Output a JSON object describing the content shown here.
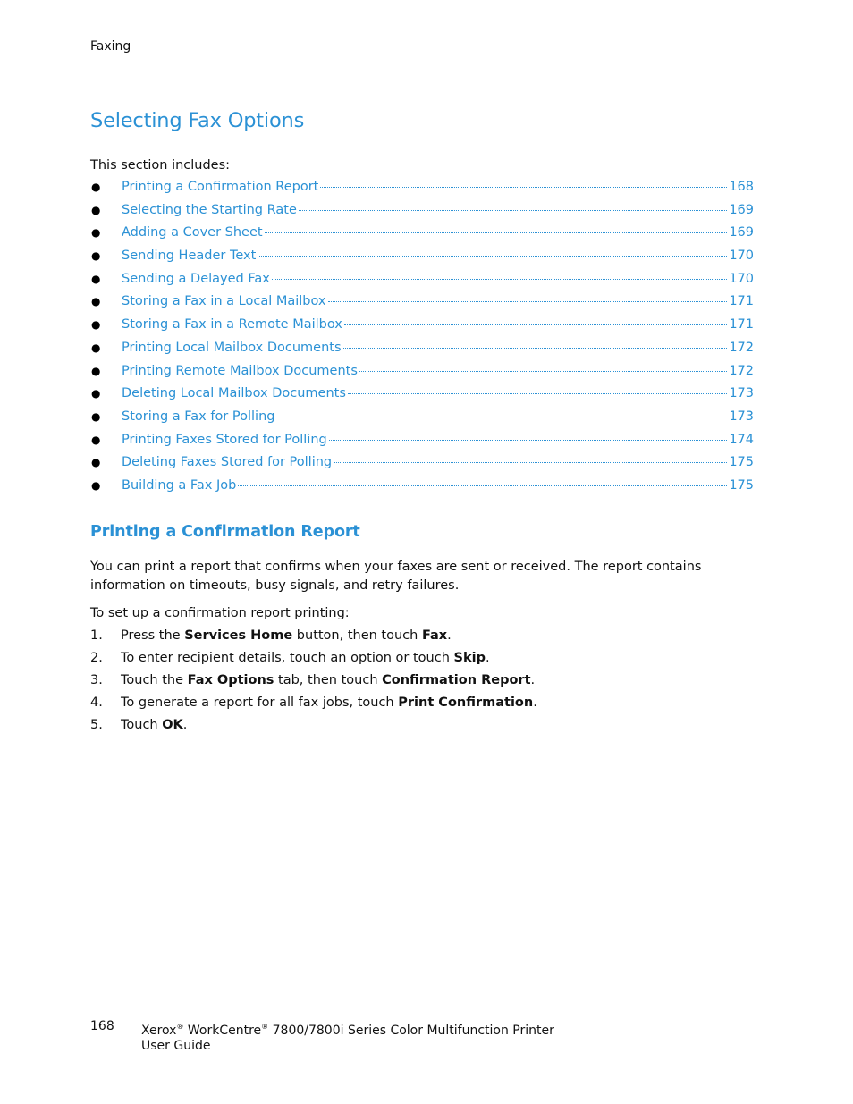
{
  "header": {
    "running_head": "Faxing"
  },
  "section": {
    "title": "Selecting Fax Options",
    "intro": "This section includes:",
    "toc": [
      {
        "title": "Printing a Confirmation Report",
        "page": "168"
      },
      {
        "title": "Selecting the Starting Rate",
        "page": "169"
      },
      {
        "title": "Adding a Cover Sheet",
        "page": "169"
      },
      {
        "title": "Sending Header Text",
        "page": "170"
      },
      {
        "title": "Sending a Delayed Fax",
        "page": "170"
      },
      {
        "title": "Storing a Fax in a Local Mailbox",
        "page": "171"
      },
      {
        "title": "Storing a Fax in a Remote Mailbox",
        "page": "171"
      },
      {
        "title": "Printing Local Mailbox Documents",
        "page": "172"
      },
      {
        "title": "Printing Remote Mailbox Documents",
        "page": "172"
      },
      {
        "title": "Deleting Local Mailbox Documents",
        "page": "173"
      },
      {
        "title": "Storing a Fax for Polling",
        "page": "173"
      },
      {
        "title": "Printing Faxes Stored for Polling",
        "page": "174"
      },
      {
        "title": "Deleting Faxes Stored for Polling",
        "page": "175"
      },
      {
        "title": "Building a Fax Job",
        "page": "175"
      }
    ]
  },
  "subsection": {
    "title": "Printing a Confirmation Report",
    "paragraph": "You can print a report that confirms when your faxes are sent or received. The report contains information on timeouts, busy signals, and retry failures.",
    "steps_intro": "To set up a confirmation report printing:",
    "steps": [
      {
        "num": "1.",
        "parts": [
          "Press the ",
          "Services Home",
          " button, then touch ",
          "Fax",
          "."
        ]
      },
      {
        "num": "2.",
        "parts": [
          "To enter recipient details, touch an option or touch ",
          "Skip",
          "."
        ]
      },
      {
        "num": "3.",
        "parts": [
          "Touch the ",
          "Fax Options",
          " tab, then touch ",
          "Confirmation Report",
          "."
        ]
      },
      {
        "num": "4.",
        "parts": [
          "To generate a report for all fax jobs, touch ",
          "Print Confirmation",
          "."
        ]
      },
      {
        "num": "5.",
        "parts": [
          "Touch ",
          "OK",
          "."
        ]
      }
    ]
  },
  "footer": {
    "page_number": "168",
    "brand": "Xerox",
    "product": "WorkCentre",
    "registered": "®",
    "model_line": "7800/7800i Series Color Multifunction Printer",
    "guide": "User Guide"
  },
  "colors": {
    "accent": "#2b91d5",
    "text": "#111111"
  }
}
